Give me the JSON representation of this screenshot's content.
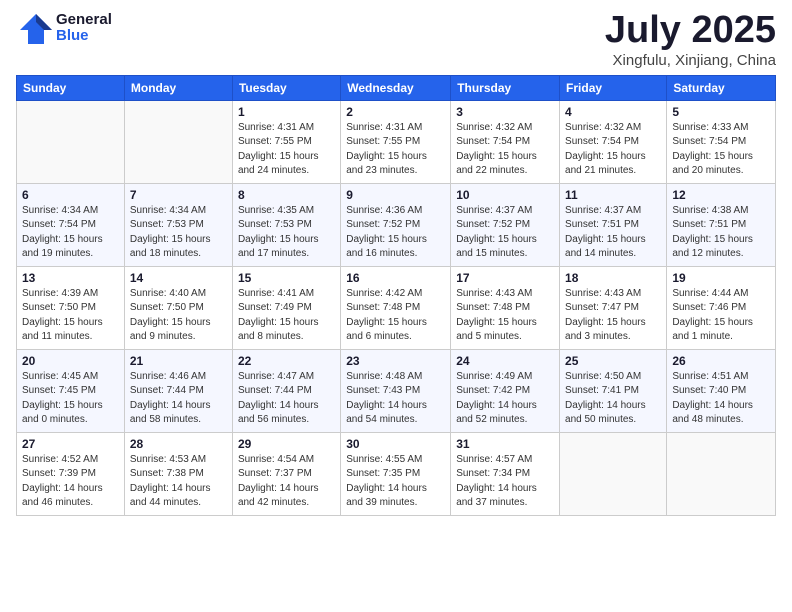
{
  "logo": {
    "general": "General",
    "blue": "Blue"
  },
  "title": {
    "month": "July 2025",
    "location": "Xingfulu, Xinjiang, China"
  },
  "weekdays": [
    "Sunday",
    "Monday",
    "Tuesday",
    "Wednesday",
    "Thursday",
    "Friday",
    "Saturday"
  ],
  "weeks": [
    [
      {
        "day": "",
        "info": ""
      },
      {
        "day": "",
        "info": ""
      },
      {
        "day": "1",
        "info": "Sunrise: 4:31 AM\nSunset: 7:55 PM\nDaylight: 15 hours and 24 minutes."
      },
      {
        "day": "2",
        "info": "Sunrise: 4:31 AM\nSunset: 7:55 PM\nDaylight: 15 hours and 23 minutes."
      },
      {
        "day": "3",
        "info": "Sunrise: 4:32 AM\nSunset: 7:54 PM\nDaylight: 15 hours and 22 minutes."
      },
      {
        "day": "4",
        "info": "Sunrise: 4:32 AM\nSunset: 7:54 PM\nDaylight: 15 hours and 21 minutes."
      },
      {
        "day": "5",
        "info": "Sunrise: 4:33 AM\nSunset: 7:54 PM\nDaylight: 15 hours and 20 minutes."
      }
    ],
    [
      {
        "day": "6",
        "info": "Sunrise: 4:34 AM\nSunset: 7:54 PM\nDaylight: 15 hours and 19 minutes."
      },
      {
        "day": "7",
        "info": "Sunrise: 4:34 AM\nSunset: 7:53 PM\nDaylight: 15 hours and 18 minutes."
      },
      {
        "day": "8",
        "info": "Sunrise: 4:35 AM\nSunset: 7:53 PM\nDaylight: 15 hours and 17 minutes."
      },
      {
        "day": "9",
        "info": "Sunrise: 4:36 AM\nSunset: 7:52 PM\nDaylight: 15 hours and 16 minutes."
      },
      {
        "day": "10",
        "info": "Sunrise: 4:37 AM\nSunset: 7:52 PM\nDaylight: 15 hours and 15 minutes."
      },
      {
        "day": "11",
        "info": "Sunrise: 4:37 AM\nSunset: 7:51 PM\nDaylight: 15 hours and 14 minutes."
      },
      {
        "day": "12",
        "info": "Sunrise: 4:38 AM\nSunset: 7:51 PM\nDaylight: 15 hours and 12 minutes."
      }
    ],
    [
      {
        "day": "13",
        "info": "Sunrise: 4:39 AM\nSunset: 7:50 PM\nDaylight: 15 hours and 11 minutes."
      },
      {
        "day": "14",
        "info": "Sunrise: 4:40 AM\nSunset: 7:50 PM\nDaylight: 15 hours and 9 minutes."
      },
      {
        "day": "15",
        "info": "Sunrise: 4:41 AM\nSunset: 7:49 PM\nDaylight: 15 hours and 8 minutes."
      },
      {
        "day": "16",
        "info": "Sunrise: 4:42 AM\nSunset: 7:48 PM\nDaylight: 15 hours and 6 minutes."
      },
      {
        "day": "17",
        "info": "Sunrise: 4:43 AM\nSunset: 7:48 PM\nDaylight: 15 hours and 5 minutes."
      },
      {
        "day": "18",
        "info": "Sunrise: 4:43 AM\nSunset: 7:47 PM\nDaylight: 15 hours and 3 minutes."
      },
      {
        "day": "19",
        "info": "Sunrise: 4:44 AM\nSunset: 7:46 PM\nDaylight: 15 hours and 1 minute."
      }
    ],
    [
      {
        "day": "20",
        "info": "Sunrise: 4:45 AM\nSunset: 7:45 PM\nDaylight: 15 hours and 0 minutes."
      },
      {
        "day": "21",
        "info": "Sunrise: 4:46 AM\nSunset: 7:44 PM\nDaylight: 14 hours and 58 minutes."
      },
      {
        "day": "22",
        "info": "Sunrise: 4:47 AM\nSunset: 7:44 PM\nDaylight: 14 hours and 56 minutes."
      },
      {
        "day": "23",
        "info": "Sunrise: 4:48 AM\nSunset: 7:43 PM\nDaylight: 14 hours and 54 minutes."
      },
      {
        "day": "24",
        "info": "Sunrise: 4:49 AM\nSunset: 7:42 PM\nDaylight: 14 hours and 52 minutes."
      },
      {
        "day": "25",
        "info": "Sunrise: 4:50 AM\nSunset: 7:41 PM\nDaylight: 14 hours and 50 minutes."
      },
      {
        "day": "26",
        "info": "Sunrise: 4:51 AM\nSunset: 7:40 PM\nDaylight: 14 hours and 48 minutes."
      }
    ],
    [
      {
        "day": "27",
        "info": "Sunrise: 4:52 AM\nSunset: 7:39 PM\nDaylight: 14 hours and 46 minutes."
      },
      {
        "day": "28",
        "info": "Sunrise: 4:53 AM\nSunset: 7:38 PM\nDaylight: 14 hours and 44 minutes."
      },
      {
        "day": "29",
        "info": "Sunrise: 4:54 AM\nSunset: 7:37 PM\nDaylight: 14 hours and 42 minutes."
      },
      {
        "day": "30",
        "info": "Sunrise: 4:55 AM\nSunset: 7:35 PM\nDaylight: 14 hours and 39 minutes."
      },
      {
        "day": "31",
        "info": "Sunrise: 4:57 AM\nSunset: 7:34 PM\nDaylight: 14 hours and 37 minutes."
      },
      {
        "day": "",
        "info": ""
      },
      {
        "day": "",
        "info": ""
      }
    ]
  ]
}
